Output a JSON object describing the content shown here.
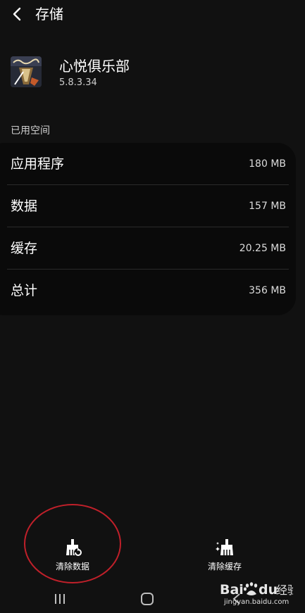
{
  "header": {
    "back_icon": "chevron-left-icon",
    "title": "存储"
  },
  "app": {
    "name": "心悦俱乐部",
    "version": "5.8.3.34",
    "icon": "app-logo-icon"
  },
  "storage": {
    "section_label": "已用空间",
    "rows": [
      {
        "label": "应用程序",
        "value": "180 MB"
      },
      {
        "label": "数据",
        "value": "157 MB"
      },
      {
        "label": "缓存",
        "value": "20.25 MB"
      },
      {
        "label": "总计",
        "value": "356 MB"
      }
    ]
  },
  "actions": {
    "clear_data": {
      "label": "清除数据",
      "icon": "broom-clear-data-icon"
    },
    "clear_cache": {
      "label": "清除缓存",
      "icon": "broom-clear-cache-icon"
    }
  },
  "navbar": {
    "recents_icon": "recents-icon",
    "home_icon": "home-icon",
    "back_icon": "back-chevron-icon"
  },
  "watermark": {
    "logo": "baidu-jingyan-logo",
    "site": "jingyan.baidu.com"
  },
  "colors": {
    "background": "#111111",
    "card": "#0a0a0a",
    "annotation": "#c0202a",
    "text_primary": "#ffffff",
    "text_secondary": "#cfcfcf"
  }
}
